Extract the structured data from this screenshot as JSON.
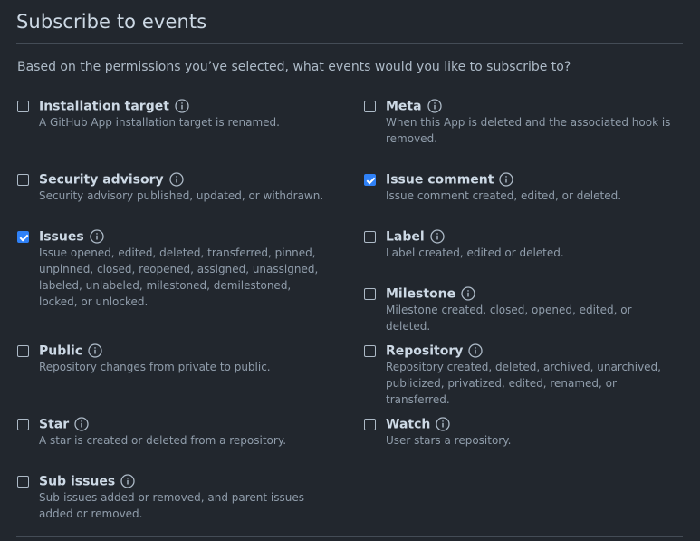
{
  "header": {
    "title": "Subscribe to events"
  },
  "intro": "Based on the permissions you’ve selected, what events would you like to subscribe to?",
  "events": {
    "installation_target": {
      "title": "Installation target",
      "description": "A GitHub App installation target is renamed.",
      "checked": false
    },
    "meta": {
      "title": "Meta",
      "description": "When this App is deleted and the associated hook is removed.",
      "checked": false
    },
    "security_advisory": {
      "title": "Security advisory",
      "description": "Security advisory published, updated, or withdrawn.",
      "checked": false
    },
    "issue_comment": {
      "title": "Issue comment",
      "description": "Issue comment created, edited, or deleted.",
      "checked": true
    },
    "issues": {
      "title": "Issues",
      "description": "Issue opened, edited, deleted, transferred, pinned, unpinned, closed, reopened, assigned, unassigned, labeled, unlabeled, milestoned, demilestoned, locked, or unlocked.",
      "checked": true
    },
    "label": {
      "title": "Label",
      "description": "Label created, edited or deleted.",
      "checked": false
    },
    "milestone": {
      "title": "Milestone",
      "description": "Milestone created, closed, opened, edited, or deleted.",
      "checked": false
    },
    "public": {
      "title": "Public",
      "description": "Repository changes from private to public.",
      "checked": false
    },
    "repository": {
      "title": "Repository",
      "description": "Repository created, deleted, archived, unarchived, publicized, privatized, edited, renamed, or transferred.",
      "checked": false
    },
    "star": {
      "title": "Star",
      "description": "A star is created or deleted from a repository.",
      "checked": false
    },
    "watch": {
      "title": "Watch",
      "description": "User stars a repository.",
      "checked": false
    },
    "sub_issues": {
      "title": "Sub issues",
      "description": "Sub-issues added or removed, and parent issues added or removed.",
      "checked": false
    }
  },
  "icons": {
    "info": "info-circle-icon"
  },
  "colors": {
    "background": "#22272e",
    "checkbox_checked": "#2f81f7",
    "title_text": "#cdd9e5",
    "description_text": "#909dab"
  }
}
